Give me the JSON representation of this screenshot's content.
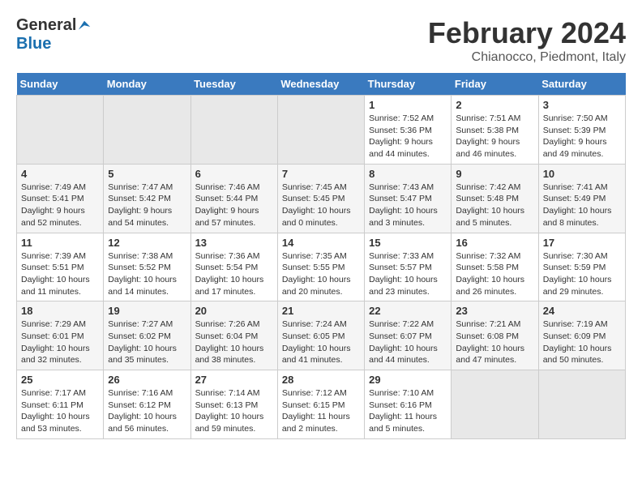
{
  "header": {
    "logo": {
      "text_general": "General",
      "text_blue": "Blue"
    },
    "title": "February 2024",
    "subtitle": "Chianocco, Piedmont, Italy"
  },
  "calendar": {
    "days_of_week": [
      "Sunday",
      "Monday",
      "Tuesday",
      "Wednesday",
      "Thursday",
      "Friday",
      "Saturday"
    ],
    "weeks": [
      [
        {
          "day": "",
          "info": ""
        },
        {
          "day": "",
          "info": ""
        },
        {
          "day": "",
          "info": ""
        },
        {
          "day": "",
          "info": ""
        },
        {
          "day": "1",
          "info": "Sunrise: 7:52 AM\nSunset: 5:36 PM\nDaylight: 9 hours\nand 44 minutes."
        },
        {
          "day": "2",
          "info": "Sunrise: 7:51 AM\nSunset: 5:38 PM\nDaylight: 9 hours\nand 46 minutes."
        },
        {
          "day": "3",
          "info": "Sunrise: 7:50 AM\nSunset: 5:39 PM\nDaylight: 9 hours\nand 49 minutes."
        }
      ],
      [
        {
          "day": "4",
          "info": "Sunrise: 7:49 AM\nSunset: 5:41 PM\nDaylight: 9 hours\nand 52 minutes."
        },
        {
          "day": "5",
          "info": "Sunrise: 7:47 AM\nSunset: 5:42 PM\nDaylight: 9 hours\nand 54 minutes."
        },
        {
          "day": "6",
          "info": "Sunrise: 7:46 AM\nSunset: 5:44 PM\nDaylight: 9 hours\nand 57 minutes."
        },
        {
          "day": "7",
          "info": "Sunrise: 7:45 AM\nSunset: 5:45 PM\nDaylight: 10 hours\nand 0 minutes."
        },
        {
          "day": "8",
          "info": "Sunrise: 7:43 AM\nSunset: 5:47 PM\nDaylight: 10 hours\nand 3 minutes."
        },
        {
          "day": "9",
          "info": "Sunrise: 7:42 AM\nSunset: 5:48 PM\nDaylight: 10 hours\nand 5 minutes."
        },
        {
          "day": "10",
          "info": "Sunrise: 7:41 AM\nSunset: 5:49 PM\nDaylight: 10 hours\nand 8 minutes."
        }
      ],
      [
        {
          "day": "11",
          "info": "Sunrise: 7:39 AM\nSunset: 5:51 PM\nDaylight: 10 hours\nand 11 minutes."
        },
        {
          "day": "12",
          "info": "Sunrise: 7:38 AM\nSunset: 5:52 PM\nDaylight: 10 hours\nand 14 minutes."
        },
        {
          "day": "13",
          "info": "Sunrise: 7:36 AM\nSunset: 5:54 PM\nDaylight: 10 hours\nand 17 minutes."
        },
        {
          "day": "14",
          "info": "Sunrise: 7:35 AM\nSunset: 5:55 PM\nDaylight: 10 hours\nand 20 minutes."
        },
        {
          "day": "15",
          "info": "Sunrise: 7:33 AM\nSunset: 5:57 PM\nDaylight: 10 hours\nand 23 minutes."
        },
        {
          "day": "16",
          "info": "Sunrise: 7:32 AM\nSunset: 5:58 PM\nDaylight: 10 hours\nand 26 minutes."
        },
        {
          "day": "17",
          "info": "Sunrise: 7:30 AM\nSunset: 5:59 PM\nDaylight: 10 hours\nand 29 minutes."
        }
      ],
      [
        {
          "day": "18",
          "info": "Sunrise: 7:29 AM\nSunset: 6:01 PM\nDaylight: 10 hours\nand 32 minutes."
        },
        {
          "day": "19",
          "info": "Sunrise: 7:27 AM\nSunset: 6:02 PM\nDaylight: 10 hours\nand 35 minutes."
        },
        {
          "day": "20",
          "info": "Sunrise: 7:26 AM\nSunset: 6:04 PM\nDaylight: 10 hours\nand 38 minutes."
        },
        {
          "day": "21",
          "info": "Sunrise: 7:24 AM\nSunset: 6:05 PM\nDaylight: 10 hours\nand 41 minutes."
        },
        {
          "day": "22",
          "info": "Sunrise: 7:22 AM\nSunset: 6:07 PM\nDaylight: 10 hours\nand 44 minutes."
        },
        {
          "day": "23",
          "info": "Sunrise: 7:21 AM\nSunset: 6:08 PM\nDaylight: 10 hours\nand 47 minutes."
        },
        {
          "day": "24",
          "info": "Sunrise: 7:19 AM\nSunset: 6:09 PM\nDaylight: 10 hours\nand 50 minutes."
        }
      ],
      [
        {
          "day": "25",
          "info": "Sunrise: 7:17 AM\nSunset: 6:11 PM\nDaylight: 10 hours\nand 53 minutes."
        },
        {
          "day": "26",
          "info": "Sunrise: 7:16 AM\nSunset: 6:12 PM\nDaylight: 10 hours\nand 56 minutes."
        },
        {
          "day": "27",
          "info": "Sunrise: 7:14 AM\nSunset: 6:13 PM\nDaylight: 10 hours\nand 59 minutes."
        },
        {
          "day": "28",
          "info": "Sunrise: 7:12 AM\nSunset: 6:15 PM\nDaylight: 11 hours\nand 2 minutes."
        },
        {
          "day": "29",
          "info": "Sunrise: 7:10 AM\nSunset: 6:16 PM\nDaylight: 11 hours\nand 5 minutes."
        },
        {
          "day": "",
          "info": ""
        },
        {
          "day": "",
          "info": ""
        }
      ]
    ]
  }
}
